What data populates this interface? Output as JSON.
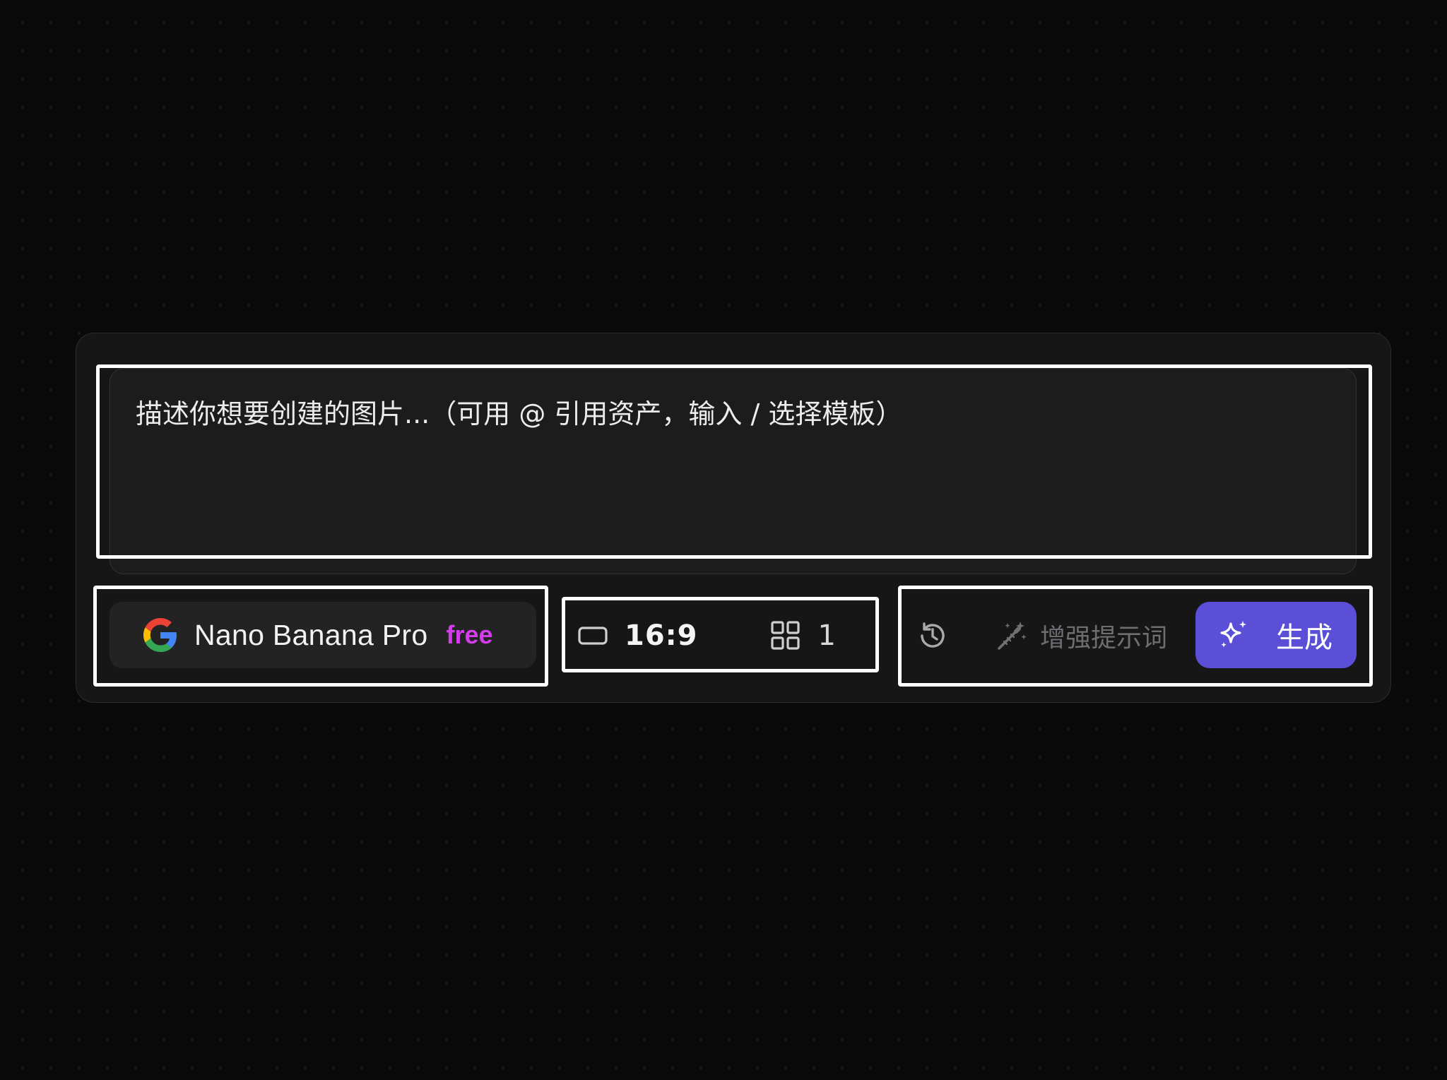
{
  "prompt": {
    "placeholder": "描述你想要创建的图片...（可用 @ 引用资产，输入 / 选择模板）"
  },
  "model": {
    "name": "Nano Banana Pro",
    "badge": "free",
    "icon": "google-g-icon",
    "badge_color": "#d63bf0"
  },
  "settings": {
    "aspect_ratio": "16:9",
    "ratio_icon": "rectangle-icon",
    "image_count": "1",
    "count_icon": "grid-icon"
  },
  "actions": {
    "history_icon": "history-icon",
    "enhance_label": "增强提示词",
    "enhance_icon": "magic-wand-icon",
    "generate_label": "生成",
    "generate_icon": "sparkle-icon",
    "generate_color": "#5a4fd6"
  }
}
